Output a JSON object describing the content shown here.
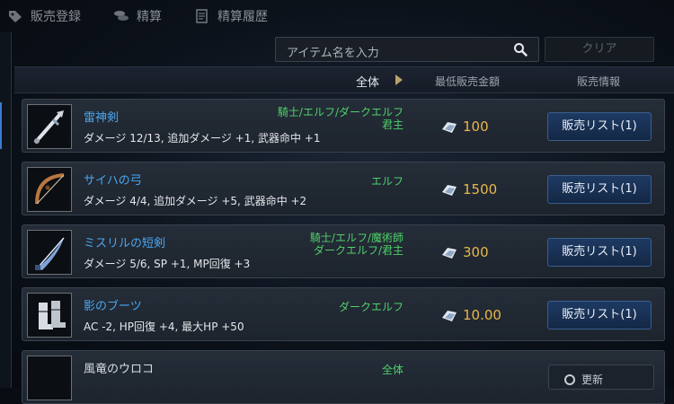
{
  "tabs": [
    {
      "label": "販売登録",
      "icon": "tag-icon"
    },
    {
      "label": "精算",
      "icon": "coins-icon"
    },
    {
      "label": "精算履歴",
      "icon": "history-icon"
    }
  ],
  "search": {
    "placeholder": "アイテム名を入力",
    "clear_label": "クリア"
  },
  "header": {
    "filter_label": "全体",
    "price_col": "最低販売金額",
    "info_col": "販売情報"
  },
  "items": [
    {
      "name": "雷神剣",
      "stats": "ダメージ 12/13, 追加ダメージ +1, 武器命中 +1",
      "class_lines": [
        "騎士/エルフ/ダークエルフ",
        "君主"
      ],
      "price": "100",
      "button": "販売リスト(1)",
      "icon": "sword-icon"
    },
    {
      "name": "サイハの弓",
      "stats": "ダメージ 4/4, 追加ダメージ +5, 武器命中 +2",
      "class_lines": [
        "エルフ"
      ],
      "price": "1500",
      "button": "販売リスト(1)",
      "icon": "bow-icon"
    },
    {
      "name": "ミスリルの短剣",
      "stats": "ダメージ 5/6, SP +1, MP回復 +3",
      "class_lines": [
        "騎士/エルフ/魔術師",
        "ダークエルフ/君主"
      ],
      "price": "300",
      "button": "販売リスト(1)",
      "icon": "dagger-icon"
    },
    {
      "name": "影のブーツ",
      "stats": "AC -2, HP回復 +4, 最大HP +50",
      "class_lines": [
        "ダークエルフ"
      ],
      "price": "10.00",
      "button": "販売リスト(1)",
      "icon": "boots-icon"
    },
    {
      "name": "風竜のウロコ",
      "stats": "",
      "class_lines": [
        "全体"
      ],
      "price": "",
      "button": "",
      "icon": "scale-icon"
    }
  ],
  "bottom": {
    "label": "更新"
  },
  "colors": {
    "item_name": "#4aa7f0",
    "class_text": "#4fd06a",
    "price": "#e8b84a",
    "button_bg": "#1e3a63"
  }
}
